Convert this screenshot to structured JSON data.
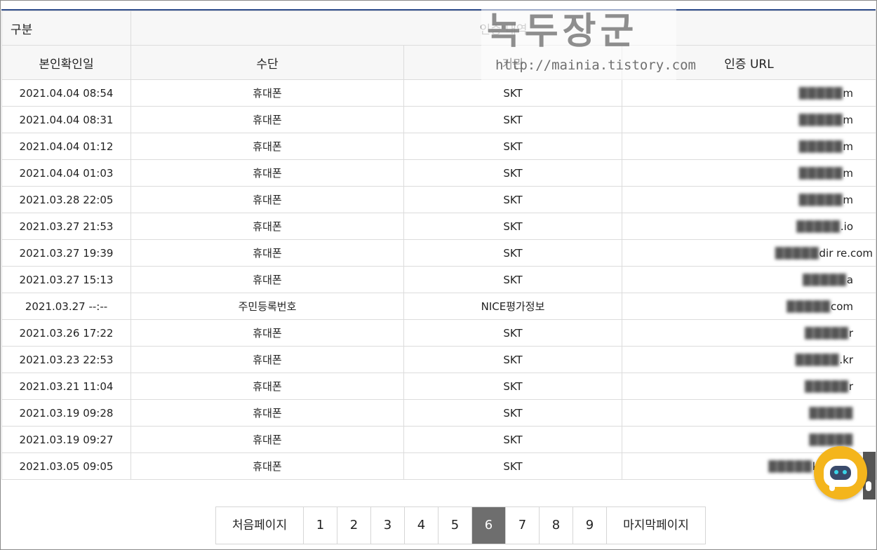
{
  "table": {
    "category_label": "구분",
    "category_title": "인증 내역",
    "columns": [
      "본인확인일",
      "수단",
      "기관",
      "인증 URL"
    ],
    "rows": [
      {
        "date": "2021.04.04 08:54",
        "method": "휴대폰",
        "agency": "SKT",
        "url": "m"
      },
      {
        "date": "2021.04.04 08:31",
        "method": "휴대폰",
        "agency": "SKT",
        "url": "m"
      },
      {
        "date": "2021.04.04 01:12",
        "method": "휴대폰",
        "agency": "SKT",
        "url": "m"
      },
      {
        "date": "2021.04.04 01:03",
        "method": "휴대폰",
        "agency": "SKT",
        "url": "m"
      },
      {
        "date": "2021.03.28 22:05",
        "method": "휴대폰",
        "agency": "SKT",
        "url": "m"
      },
      {
        "date": "2021.03.27 21:53",
        "method": "휴대폰",
        "agency": "SKT",
        "url": ".io"
      },
      {
        "date": "2021.03.27 19:39",
        "method": "휴대폰",
        "agency": "SKT",
        "url": "dir re.com"
      },
      {
        "date": "2021.03.27 15:13",
        "method": "휴대폰",
        "agency": "SKT",
        "url": "a"
      },
      {
        "date": "2021.03.27 --:--",
        "method": "주민등록번호",
        "agency": "NICE평가정보",
        "url": "com"
      },
      {
        "date": "2021.03.26 17:22",
        "method": "휴대폰",
        "agency": "SKT",
        "url": "r"
      },
      {
        "date": "2021.03.23 22:53",
        "method": "휴대폰",
        "agency": "SKT",
        "url": ".kr"
      },
      {
        "date": "2021.03.21 11:04",
        "method": "휴대폰",
        "agency": "SKT",
        "url": "r"
      },
      {
        "date": "2021.03.19 09:28",
        "method": "휴대폰",
        "agency": "SKT",
        "url": ""
      },
      {
        "date": "2021.03.19 09:27",
        "method": "휴대폰",
        "agency": "SKT",
        "url": ""
      },
      {
        "date": "2021.03.05 09:05",
        "method": "휴대폰",
        "agency": "SKT",
        "url": "kiwoom"
      }
    ]
  },
  "pagination": {
    "first_label": "처음페이지",
    "last_label": "마지막페이지",
    "pages": [
      "1",
      "2",
      "3",
      "4",
      "5",
      "6",
      "7",
      "8",
      "9"
    ],
    "current": "6"
  },
  "watermark": {
    "title": "녹두장군",
    "url": "http://mainia.tistory.com"
  },
  "colors": {
    "header_rule": "#2f4d8c",
    "active_page_bg": "#6e6e6e",
    "chatbot_bg": "#f4b51c"
  }
}
